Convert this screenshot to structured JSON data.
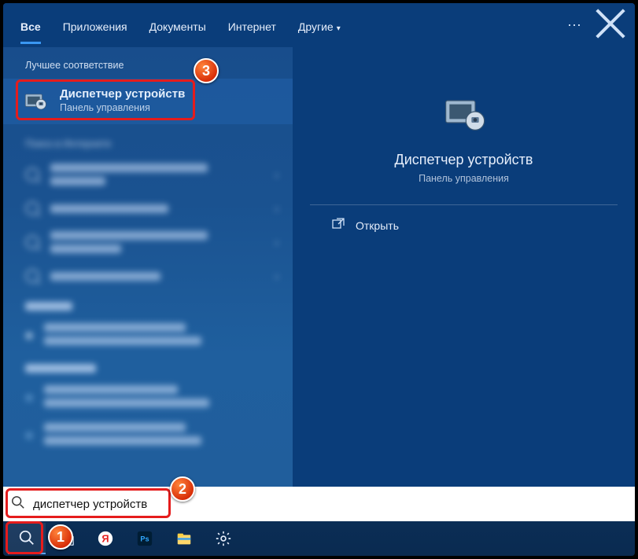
{
  "tabs": {
    "all": "Все",
    "apps": "Приложения",
    "docs": "Документы",
    "internet": "Интернет",
    "more": "Другие"
  },
  "left": {
    "section_best": "Лучшее соответствие",
    "item_title": "Диспетчер устройств",
    "item_sub": "Панель управления",
    "section_web": "Поиск в Интернете"
  },
  "right": {
    "title": "Диспетчер устройств",
    "sub": "Панель управления",
    "open": "Открыть"
  },
  "search": {
    "value": "диспетчер устройств"
  },
  "badges": {
    "b1": "1",
    "b2": "2",
    "b3": "3"
  }
}
